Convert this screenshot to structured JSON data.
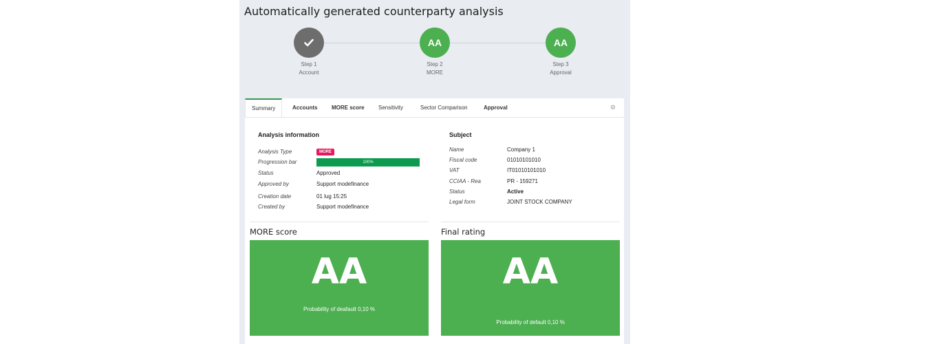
{
  "page": {
    "title": "Automatically generated counterparty analysis"
  },
  "stepper": {
    "steps": [
      {
        "number": "Step 1",
        "label": "Account",
        "icon": "check-icon",
        "color": "#6d6d6d"
      },
      {
        "number": "Step 2",
        "label": "MORE",
        "value": "AA",
        "color": "#4caf50"
      },
      {
        "number": "Step 3",
        "label": "Approval",
        "value": "AA",
        "color": "#4caf50"
      }
    ]
  },
  "tabs": [
    {
      "label": "Summary"
    },
    {
      "label": "Accounts"
    },
    {
      "label": "MORE score"
    },
    {
      "label": "Sensitivity"
    },
    {
      "label": "Sector Comparison"
    },
    {
      "label": "Approval"
    }
  ],
  "analysis": {
    "title": "Analysis information",
    "type_label": "Analysis Type",
    "type_badge": "MORE",
    "progress_label": "Progression bar",
    "progress_text": "100%",
    "progress_value": 1.0,
    "status_label": "Status",
    "status_value": "Approved",
    "approved_by_label": "Approved by",
    "approved_by_value": "Support modefinance",
    "creation_date_label": "Creation date",
    "creation_date_value": "01 lug 15:25",
    "created_by_label": "Created by",
    "created_by_value": "Support modefinance"
  },
  "subject": {
    "title": "Subject",
    "name_label": "Name",
    "name_value": "Company 1",
    "fiscal_label": "Fiscal code",
    "fiscal_value": "01010101010",
    "vat_label": "VAT",
    "vat_value": "IT01010101010",
    "cciaa_label": "CCIAA - Rea",
    "cciaa_value": "PR - 159271",
    "status_label": "Status",
    "status_value": "Active",
    "legal_label": "Legal form",
    "legal_value": "JOINT STOCK COMPANY"
  },
  "more_score": {
    "title": "MORE score",
    "rating": "AA",
    "probability": "Probability of deafault 0,10 %"
  },
  "final_rating": {
    "title": "Final rating",
    "rating": "AA",
    "probability": "Probability of default 0,10 %"
  },
  "colors": {
    "green": "#4caf50",
    "accent_green": "#2d9a4f",
    "badge": "#e5195f",
    "panel_bg": "#e9ecf1"
  }
}
